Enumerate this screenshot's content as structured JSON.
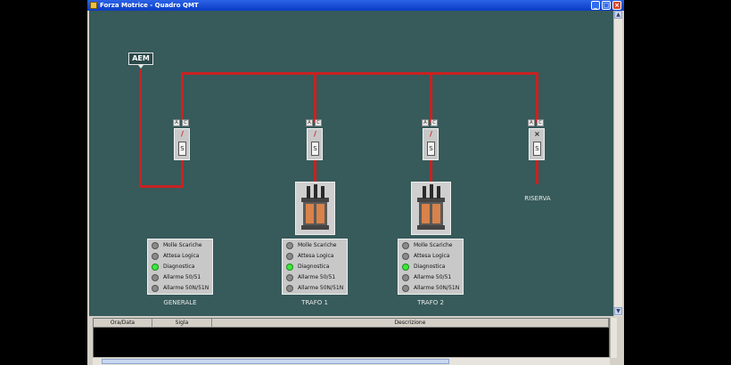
{
  "window": {
    "title": "Forza Motrice - Quadro QMT",
    "minimize_glyph": "_",
    "maximize_glyph": "□",
    "close_glyph": "×"
  },
  "scrollbar": {
    "up_glyph": "▲",
    "down_glyph": "▼"
  },
  "source": {
    "label": "AEM"
  },
  "switches": [
    {
      "btn_a": "A",
      "btn_b": "C",
      "mark": "/",
      "slot": "S"
    },
    {
      "btn_a": "A",
      "btn_b": "C",
      "mark": "/",
      "slot": "S"
    },
    {
      "btn_a": "A",
      "btn_b": "C",
      "mark": "/",
      "slot": "S"
    },
    {
      "btn_a": "A",
      "btn_b": "C",
      "mark": "×",
      "slot": "S"
    }
  ],
  "panels": [
    {
      "caption": "GENERALE",
      "rows": [
        {
          "label": "Molle Scariche",
          "status": "off"
        },
        {
          "label": "Attesa Logica",
          "status": "off"
        },
        {
          "label": "Diagnostica",
          "status": "on"
        },
        {
          "label": "Allarme 50/51",
          "status": "off"
        },
        {
          "label": "Allarme 50N/51N",
          "status": "off"
        }
      ]
    },
    {
      "caption": "TRAFO 1",
      "rows": [
        {
          "label": "Molle Scariche",
          "status": "off"
        },
        {
          "label": "Attesa Logica",
          "status": "off"
        },
        {
          "label": "Diagnostica",
          "status": "on"
        },
        {
          "label": "Allarme 50/51",
          "status": "off"
        },
        {
          "label": "Allarme 50N/51N",
          "status": "off"
        }
      ]
    },
    {
      "caption": "TRAFO 2",
      "rows": [
        {
          "label": "Molle Scariche",
          "status": "off"
        },
        {
          "label": "Attesa Logica",
          "status": "off"
        },
        {
          "label": "Diagnostica",
          "status": "on"
        },
        {
          "label": "Allarme 50/51",
          "status": "off"
        },
        {
          "label": "Allarme 50N/51N",
          "status": "off"
        }
      ]
    }
  ],
  "reserve": {
    "caption": "RISERVA"
  },
  "event_table": {
    "columns": [
      "Ora/Data",
      "Sigla",
      "Descrizione"
    ],
    "rows": []
  },
  "colors": {
    "background": "#375a5a",
    "busbar": "#c82222",
    "led_on": "#3ce83c",
    "led_off": "#8a8a8a"
  },
  "icons": {
    "transformer": "transformer-icon",
    "breaker": "breaker-icon",
    "led": "status-led-icon"
  }
}
